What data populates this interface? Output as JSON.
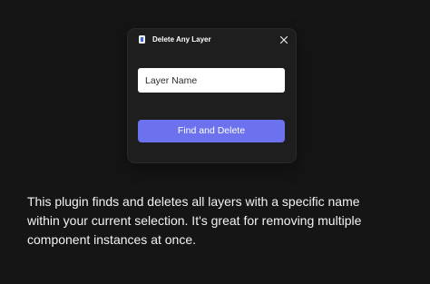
{
  "dialog": {
    "title": "Delete Any Layer",
    "icon": "plugin-icon",
    "close_icon": "close-icon",
    "input_placeholder": "Layer Name",
    "input_value": "",
    "button_label": "Find and Delete"
  },
  "description": {
    "lines": [
      "This plugin finds and deletes all layers with a specific name",
      "within your current selection. It's great for removing multiple",
      "component instances at once."
    ]
  },
  "colors": {
    "background": "#151515",
    "dialog_background": "#1e1e1e",
    "accent": "#6c72ee",
    "text": "#f3f3f3"
  }
}
